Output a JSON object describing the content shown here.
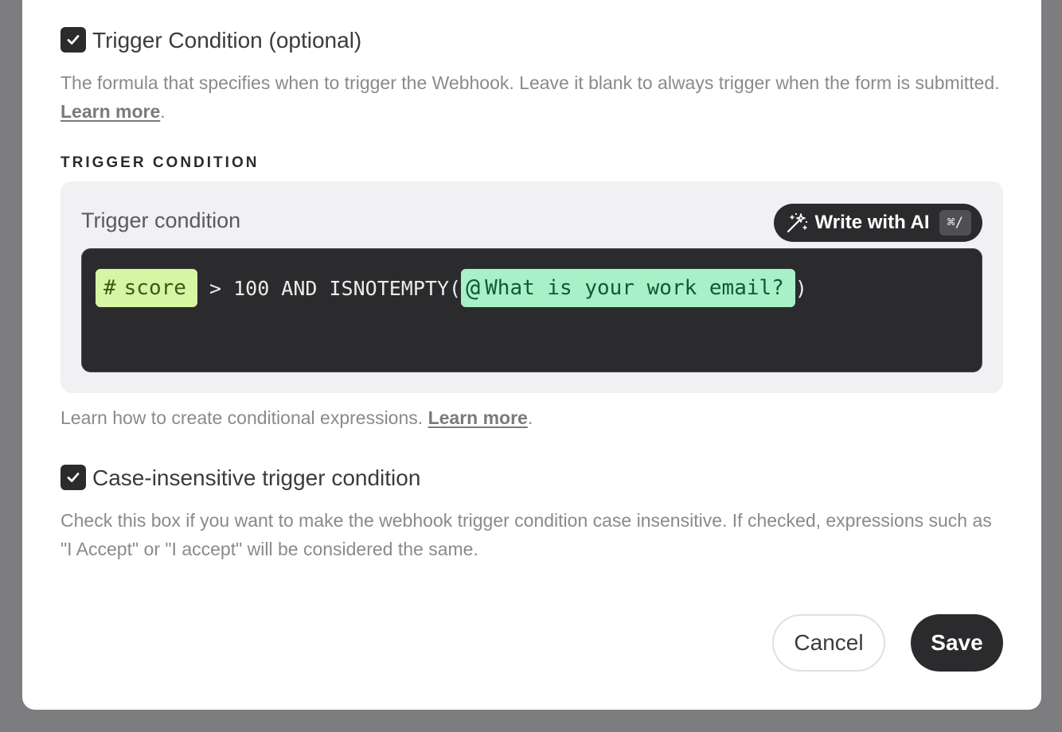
{
  "trigger_section": {
    "checkbox_checked": true,
    "checkbox_label": "Trigger Condition (optional)",
    "description": "The formula that specifies when to trigger the Webhook. Leave it blank to always trigger when the form is submitted.",
    "learn_more": "Learn more",
    "period": "."
  },
  "condition": {
    "section_title": "TRIGGER CONDITION",
    "card_label": "Trigger condition",
    "ai_button": {
      "label": "Write with AI",
      "shortcut": "⌘/",
      "icon": "magic-wand-icon"
    },
    "formula": {
      "score_chip": {
        "icon": "#",
        "label": "score"
      },
      "middle_text": " > 100 AND ISNOTEMPTY(",
      "email_chip": {
        "icon": "@",
        "label": "What is your work email?"
      },
      "end_text": ")"
    },
    "help_text": "Learn how to create conditional expressions.",
    "help_link": "Learn more",
    "help_period": "."
  },
  "case_section": {
    "checkbox_checked": true,
    "checkbox_label": "Case-insensitive trigger condition",
    "description": "Check this box if you want to make the webhook trigger condition case insensitive. If checked, expressions such as \"I Accept\" or \"I accept\" will be considered the same."
  },
  "footer": {
    "cancel_label": "Cancel",
    "save_label": "Save"
  },
  "colors": {
    "dark": "#2b2b2d",
    "score_chip_bg": "#d7f5a3",
    "email_chip_bg": "#a8f0c8",
    "muted_text": "#8a8a8e"
  }
}
